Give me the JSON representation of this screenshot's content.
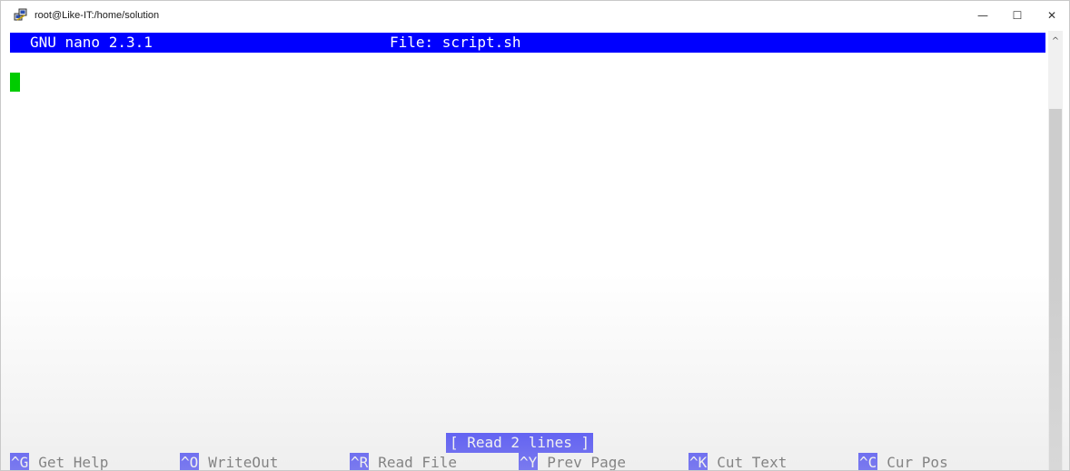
{
  "window": {
    "title": "root@Like-IT:/home/solution",
    "icon": "putty-icon",
    "controls": {
      "minimize": "—",
      "maximize": "☐",
      "close": "✕"
    }
  },
  "nano": {
    "version": "GNU nano 2.3.1",
    "file_label": "File: script.sh",
    "status_message": "[ Read 2 lines ]",
    "shortcuts": [
      {
        "key": "^G",
        "label": "Get Help"
      },
      {
        "key": "^O",
        "label": "WriteOut"
      },
      {
        "key": "^R",
        "label": "Read File"
      },
      {
        "key": "^Y",
        "label": "Prev Page"
      },
      {
        "key": "^K",
        "label": "Cut Text"
      },
      {
        "key": "^C",
        "label": "Cur Pos"
      }
    ]
  },
  "scrollbar": {
    "up_arrow": "^"
  },
  "colors": {
    "header_bg": "#0000ff",
    "header_fg": "#ffffff",
    "cursor": "#00cc00",
    "terminal_bg": "#ffffff"
  }
}
